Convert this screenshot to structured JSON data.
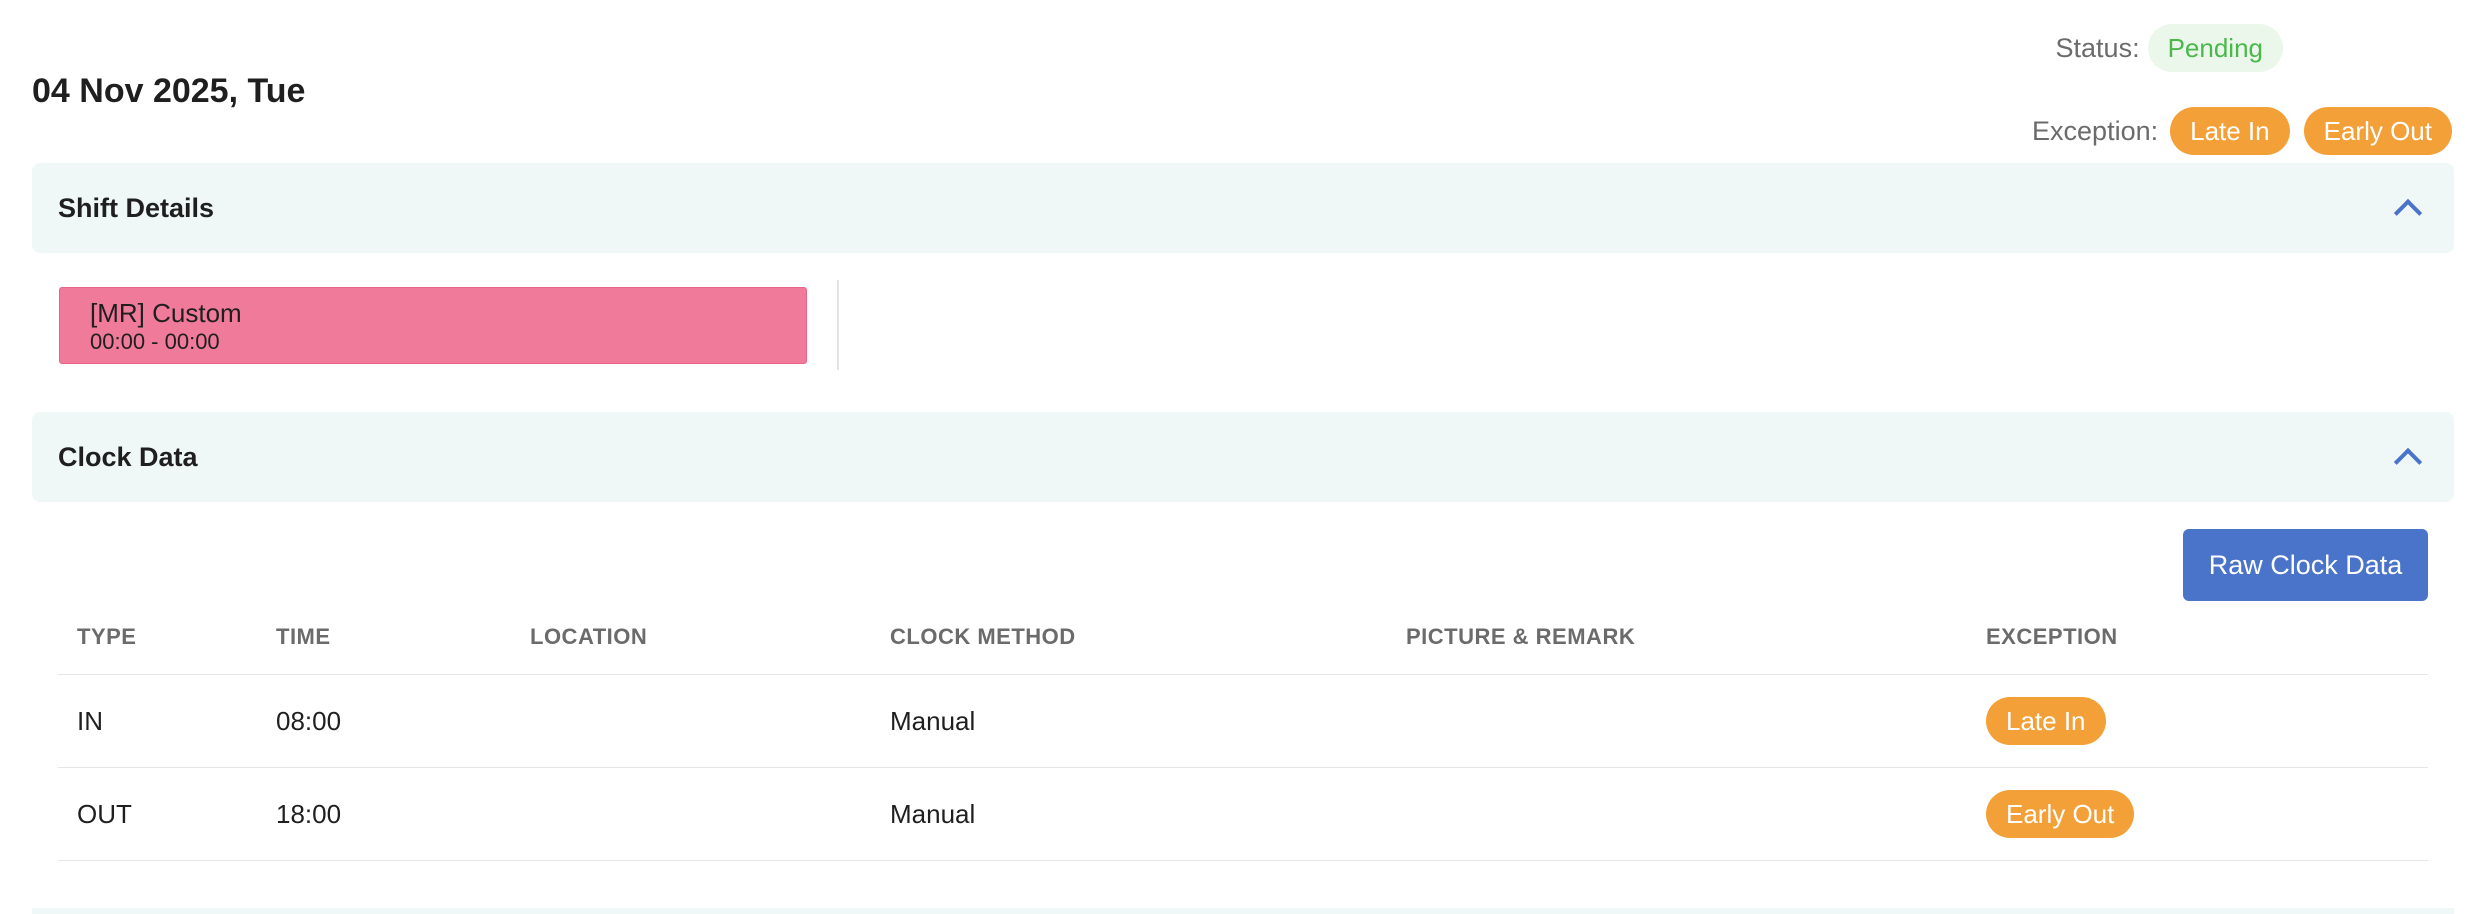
{
  "header": {
    "date": "04 Nov 2025, Tue",
    "status_label": "Status:",
    "status_value": "Pending",
    "exception_label": "Exception:",
    "exceptions": [
      "Late In",
      "Early Out"
    ]
  },
  "shift_details": {
    "title": "Shift Details",
    "shift": {
      "name": "[MR] Custom",
      "time": "00:00 - 00:00"
    }
  },
  "clock_data": {
    "title": "Clock Data",
    "raw_button_label": "Raw Clock Data",
    "columns": [
      "TYPE",
      "TIME",
      "LOCATION",
      "CLOCK METHOD",
      "PICTURE & REMARK",
      "EXCEPTION"
    ],
    "rows": [
      {
        "type": "IN",
        "time": "08:00",
        "location": "",
        "method": "Manual",
        "remark": "",
        "exception": "Late In"
      },
      {
        "type": "OUT",
        "time": "18:00",
        "location": "",
        "method": "Manual",
        "remark": "",
        "exception": "Early Out"
      }
    ]
  },
  "colors": {
    "accent": "#4a74c9",
    "exception": "#f4a038",
    "pending_bg": "#eaf7ea",
    "pending_text": "#4cb84c",
    "shift_card": "#f07a9a",
    "section_bg": "#eff8f6"
  },
  "icons": {
    "collapse": "chevron-up-icon"
  }
}
